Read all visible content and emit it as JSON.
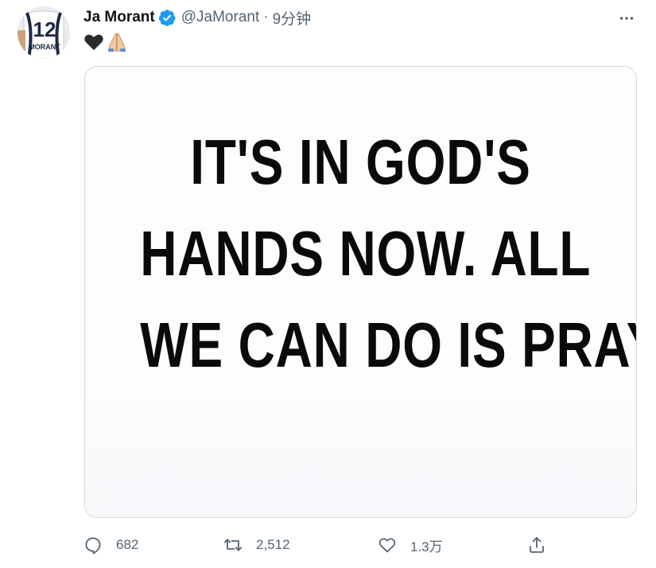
{
  "tweet": {
    "author": {
      "display_name": "Ja Morant",
      "handle": "@JaMorant",
      "verified": true,
      "avatar": {
        "jersey_number": "12",
        "jersey_name": "MORANT"
      }
    },
    "separator": "·",
    "time": "9分钟",
    "text_icons": [
      "black-heart-icon",
      "folded-hands-icon"
    ],
    "media": {
      "lines": [
        "IT'S IN GOD'S",
        "HANDS NOW. ALL",
        "WE CAN DO IS PRAY."
      ]
    },
    "actions": {
      "reply_count": "682",
      "retweet_count": "2,512",
      "like_count": "1.3万"
    }
  },
  "colors": {
    "verified_blue": "#1d9bf0",
    "muted_text": "#536471",
    "primary_text": "#0f1419",
    "border": "#cfd9de"
  }
}
